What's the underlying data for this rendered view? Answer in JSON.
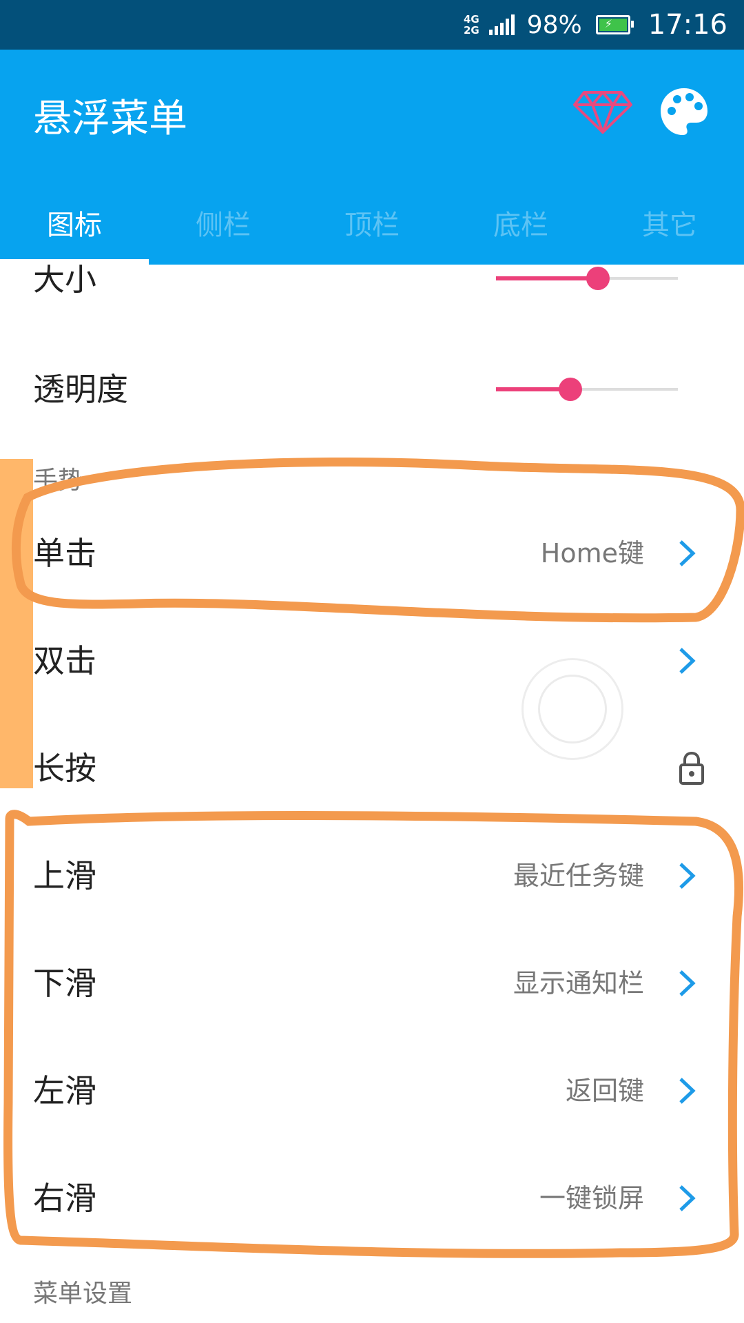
{
  "status_bar": {
    "network_top": "4G",
    "network_bottom": "2G",
    "battery_percent": "98%",
    "time": "17:16",
    "battery_color": "#3fc34a"
  },
  "app_bar": {
    "title": "悬浮菜单",
    "background": "#07a3ef",
    "icons": [
      "diamond-icon",
      "palette-icon"
    ]
  },
  "tabs": [
    {
      "label": "图标",
      "active": true
    },
    {
      "label": "侧栏",
      "active": false
    },
    {
      "label": "顶栏",
      "active": false
    },
    {
      "label": "底栏",
      "active": false
    },
    {
      "label": "其它",
      "active": false
    }
  ],
  "sliders": [
    {
      "label": "大小",
      "value_fraction": 0.56
    },
    {
      "label": "透明度",
      "value_fraction": 0.41
    }
  ],
  "gesture_section": {
    "header": "手势",
    "items": [
      {
        "label": "单击",
        "value": "Home键",
        "control": "chevron"
      },
      {
        "label": "双击",
        "value": "",
        "control": "chevron"
      },
      {
        "label": "长按",
        "value": "",
        "control": "lock"
      },
      {
        "label": "上滑",
        "value": "最近任务键",
        "control": "chevron"
      },
      {
        "label": "下滑",
        "value": "显示通知栏",
        "control": "chevron"
      },
      {
        "label": "左滑",
        "value": "返回键",
        "control": "chevron"
      },
      {
        "label": "右滑",
        "value": "一键锁屏",
        "control": "chevron"
      }
    ]
  },
  "menu_section": {
    "header": "菜单设置"
  },
  "colors": {
    "accent_slider": "#ec407a",
    "chevron": "#1e9be8",
    "annotation": "#f39a4e"
  }
}
